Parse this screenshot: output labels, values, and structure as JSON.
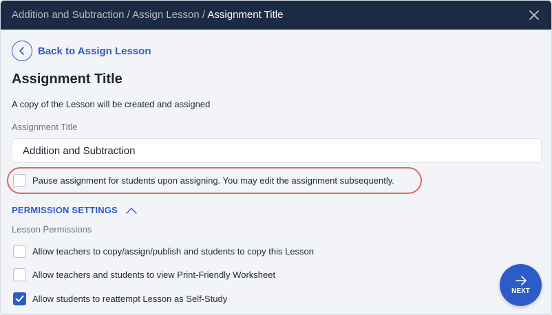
{
  "header": {
    "breadcrumb": [
      "Addition and Subtraction",
      "Assign Lesson",
      "Assignment Title"
    ],
    "separator": "/"
  },
  "back": {
    "label": "Back to Assign Lesson"
  },
  "page": {
    "title": "Assignment Title",
    "subtitle": "A copy of the Lesson will be created and assigned"
  },
  "assignment_title_field": {
    "label": "Assignment Title",
    "value": "Addition and Subtraction"
  },
  "pause_option": {
    "label": "Pause assignment for students upon assigning. You may edit the assignment subsequently.",
    "checked": false
  },
  "permissions": {
    "title": "PERMISSION SETTINGS",
    "expanded": true,
    "subheading": "Lesson Permissions",
    "items": [
      {
        "label": "Allow teachers to copy/assign/publish and students to copy this Lesson",
        "checked": false
      },
      {
        "label": "Allow teachers and students to view Print-Friendly Worksheet",
        "checked": false
      },
      {
        "label": "Allow students to reattempt Lesson as Self-Study",
        "checked": true
      }
    ]
  },
  "next_button": {
    "label": "NEXT"
  },
  "colors": {
    "header_bg": "#1c2b44",
    "accent": "#2d5bc8",
    "highlight": "#e06666"
  }
}
